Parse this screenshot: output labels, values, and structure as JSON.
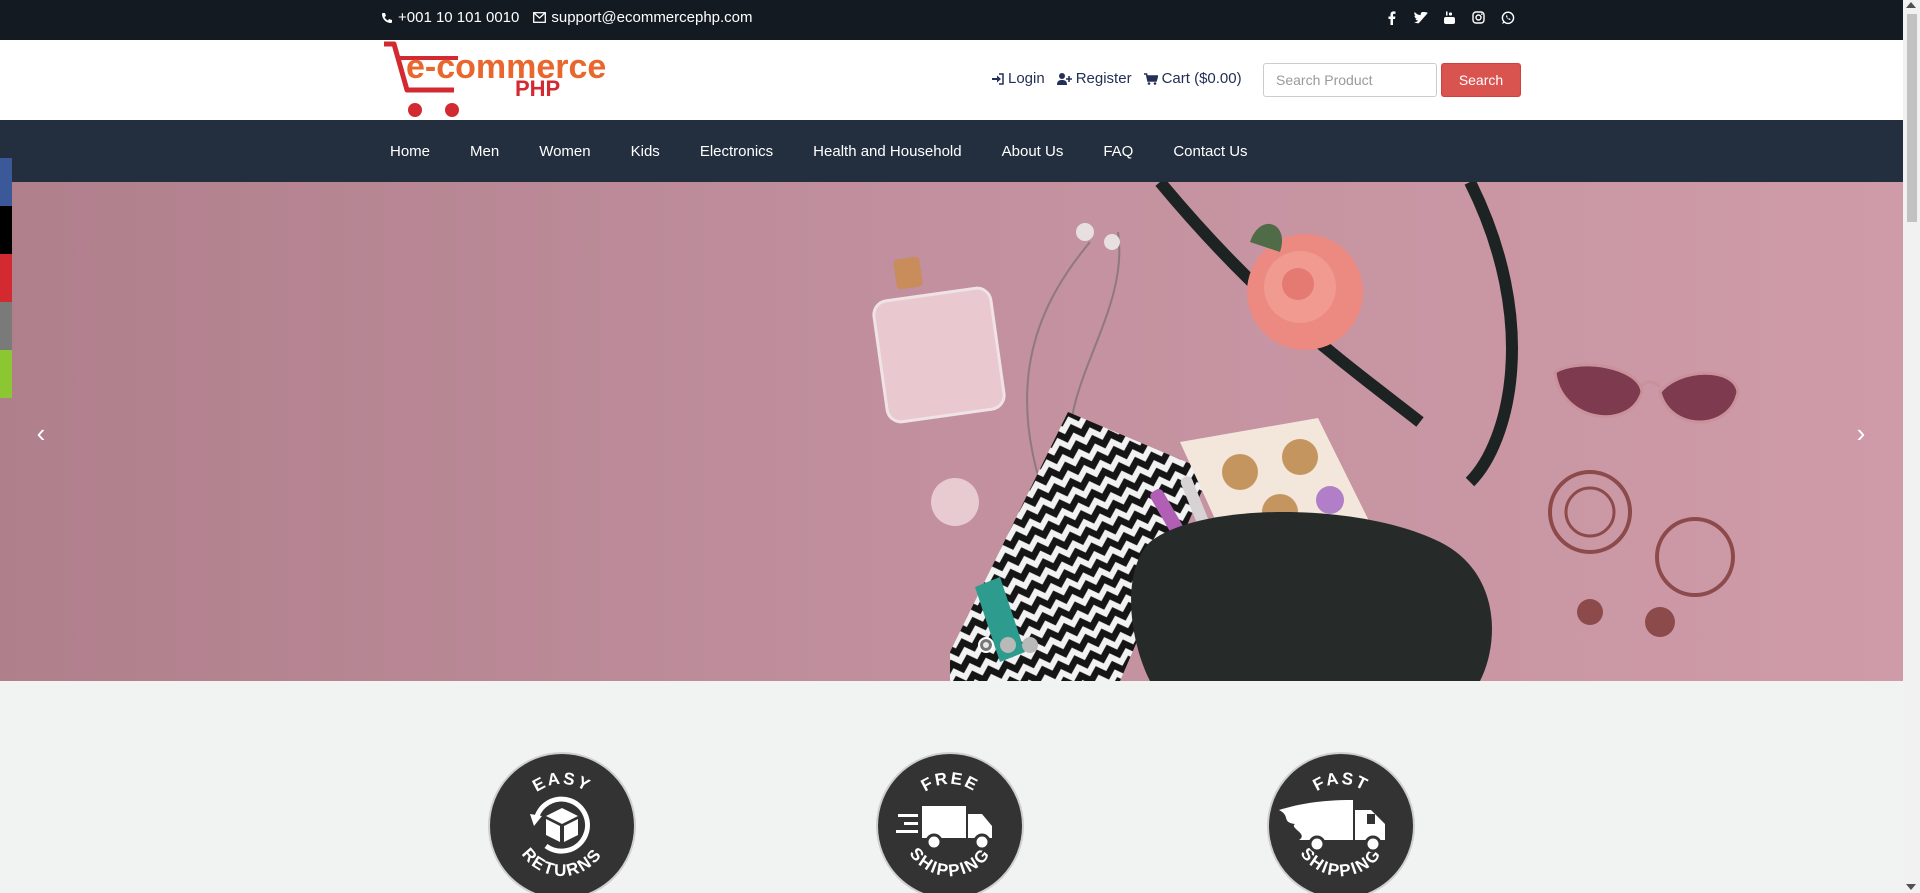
{
  "topbar": {
    "phone": "+001 10 101 0010",
    "email": "support@ecommercephp.com",
    "social": [
      "facebook-icon",
      "twitter-icon",
      "youtube-icon",
      "instagram-icon",
      "whatsapp-icon"
    ]
  },
  "header": {
    "logo_text_main": "e-commerce",
    "logo_text_sub": "PHP",
    "login_label": "Login",
    "register_label": "Register",
    "cart_label": "Cart ($0.00)",
    "search_placeholder": "Search Product",
    "search_button": "Search"
  },
  "nav": {
    "items": [
      "Home",
      "Men",
      "Women",
      "Kids",
      "Electronics",
      "Health and Household",
      "About Us",
      "FAQ",
      "Contact Us"
    ]
  },
  "slider": {
    "prev_symbol": "‹",
    "next_symbol": "›",
    "slide_count": 3,
    "active_slide": 1
  },
  "share_colors": [
    "#3b5998",
    "#000000",
    "#d32a32",
    "#7a7a7a",
    "#8ac732"
  ],
  "features": {
    "easy_returns": {
      "top": "EASY",
      "bottom": "RETURNS"
    },
    "free_shipping": {
      "top": "FREE",
      "bottom": "SHIPPING"
    },
    "fast_shipping": {
      "top": "FAST",
      "bottom": "SHIPPING"
    }
  },
  "colors": {
    "topbar": "#131a22",
    "nav": "#232f3e",
    "search_button": "#d9534f",
    "logo_orange": "#e9662c",
    "logo_red": "#d32a32"
  }
}
